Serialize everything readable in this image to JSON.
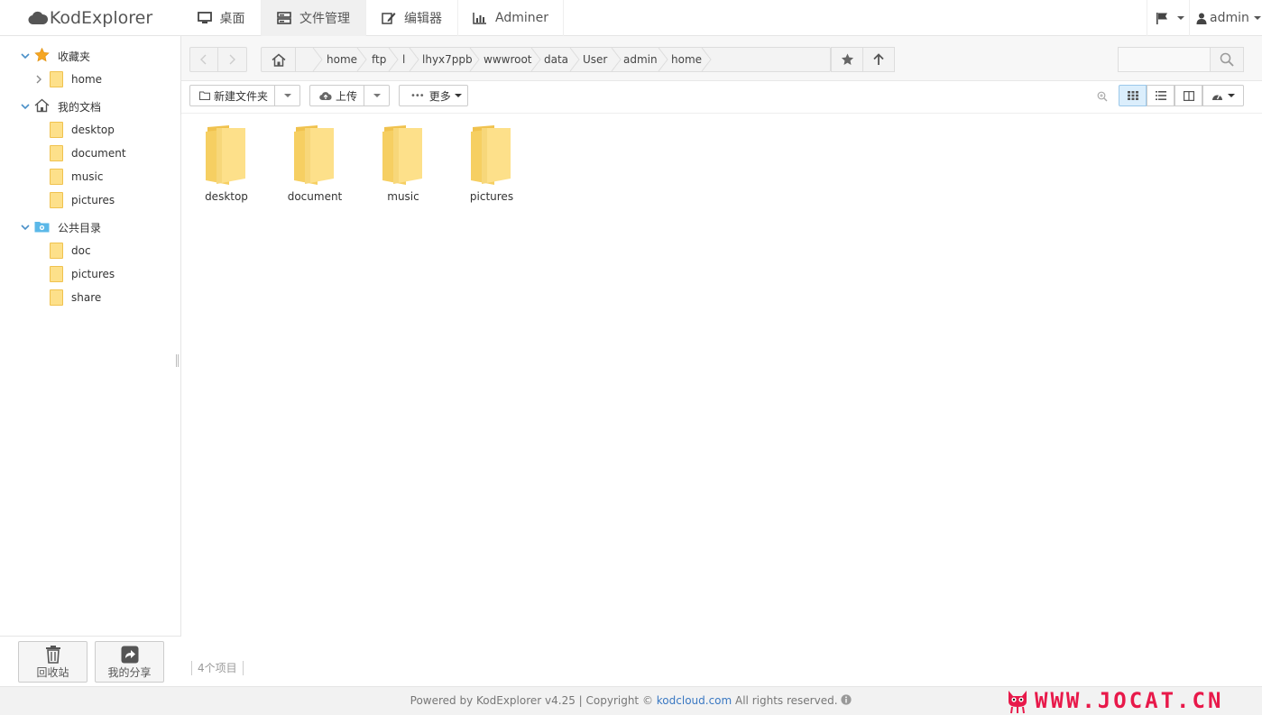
{
  "app": {
    "title": "KodExplorer"
  },
  "nav": {
    "tabs": [
      {
        "label": "桌面",
        "icon": "monitor-icon"
      },
      {
        "label": "文件管理",
        "icon": "server-icon",
        "active": true
      },
      {
        "label": "编辑器",
        "icon": "edit-icon"
      },
      {
        "label": "Adminer",
        "icon": "chart-icon"
      }
    ],
    "user": "admin"
  },
  "sidebar": {
    "groups": [
      {
        "label": "收藏夹",
        "icon": "star-icon",
        "items": [
          "home"
        ]
      },
      {
        "label": "我的文档",
        "icon": "home-icon",
        "items": [
          "desktop",
          "document",
          "music",
          "pictures"
        ]
      },
      {
        "label": "公共目录",
        "icon": "folder-share-icon",
        "items": [
          "doc",
          "pictures",
          "share"
        ]
      }
    ],
    "recycle_label": "回收站",
    "share_label": "我的分享"
  },
  "path": {
    "crumbs": [
      "home",
      "ftp",
      "l",
      "lhyx7ppb",
      "wwwroot",
      "data",
      "User",
      "admin",
      "home"
    ]
  },
  "search": {
    "placeholder": ""
  },
  "toolbar": {
    "new_folder": "新建文件夹",
    "upload": "上传",
    "more": "更多"
  },
  "files": [
    "desktop",
    "document",
    "music",
    "pictures"
  ],
  "status": {
    "count": "4个项目"
  },
  "footer": {
    "prefix": "Powered by KodExplorer v4.25 | Copyright © ",
    "link": "kodcloud.com",
    "suffix": " All rights reserved."
  },
  "watermark": "WWW.JOCAT.CN",
  "colors": {
    "folder": "#fde08a",
    "accent": "#3a78c2",
    "watermark": "#e8194a"
  }
}
